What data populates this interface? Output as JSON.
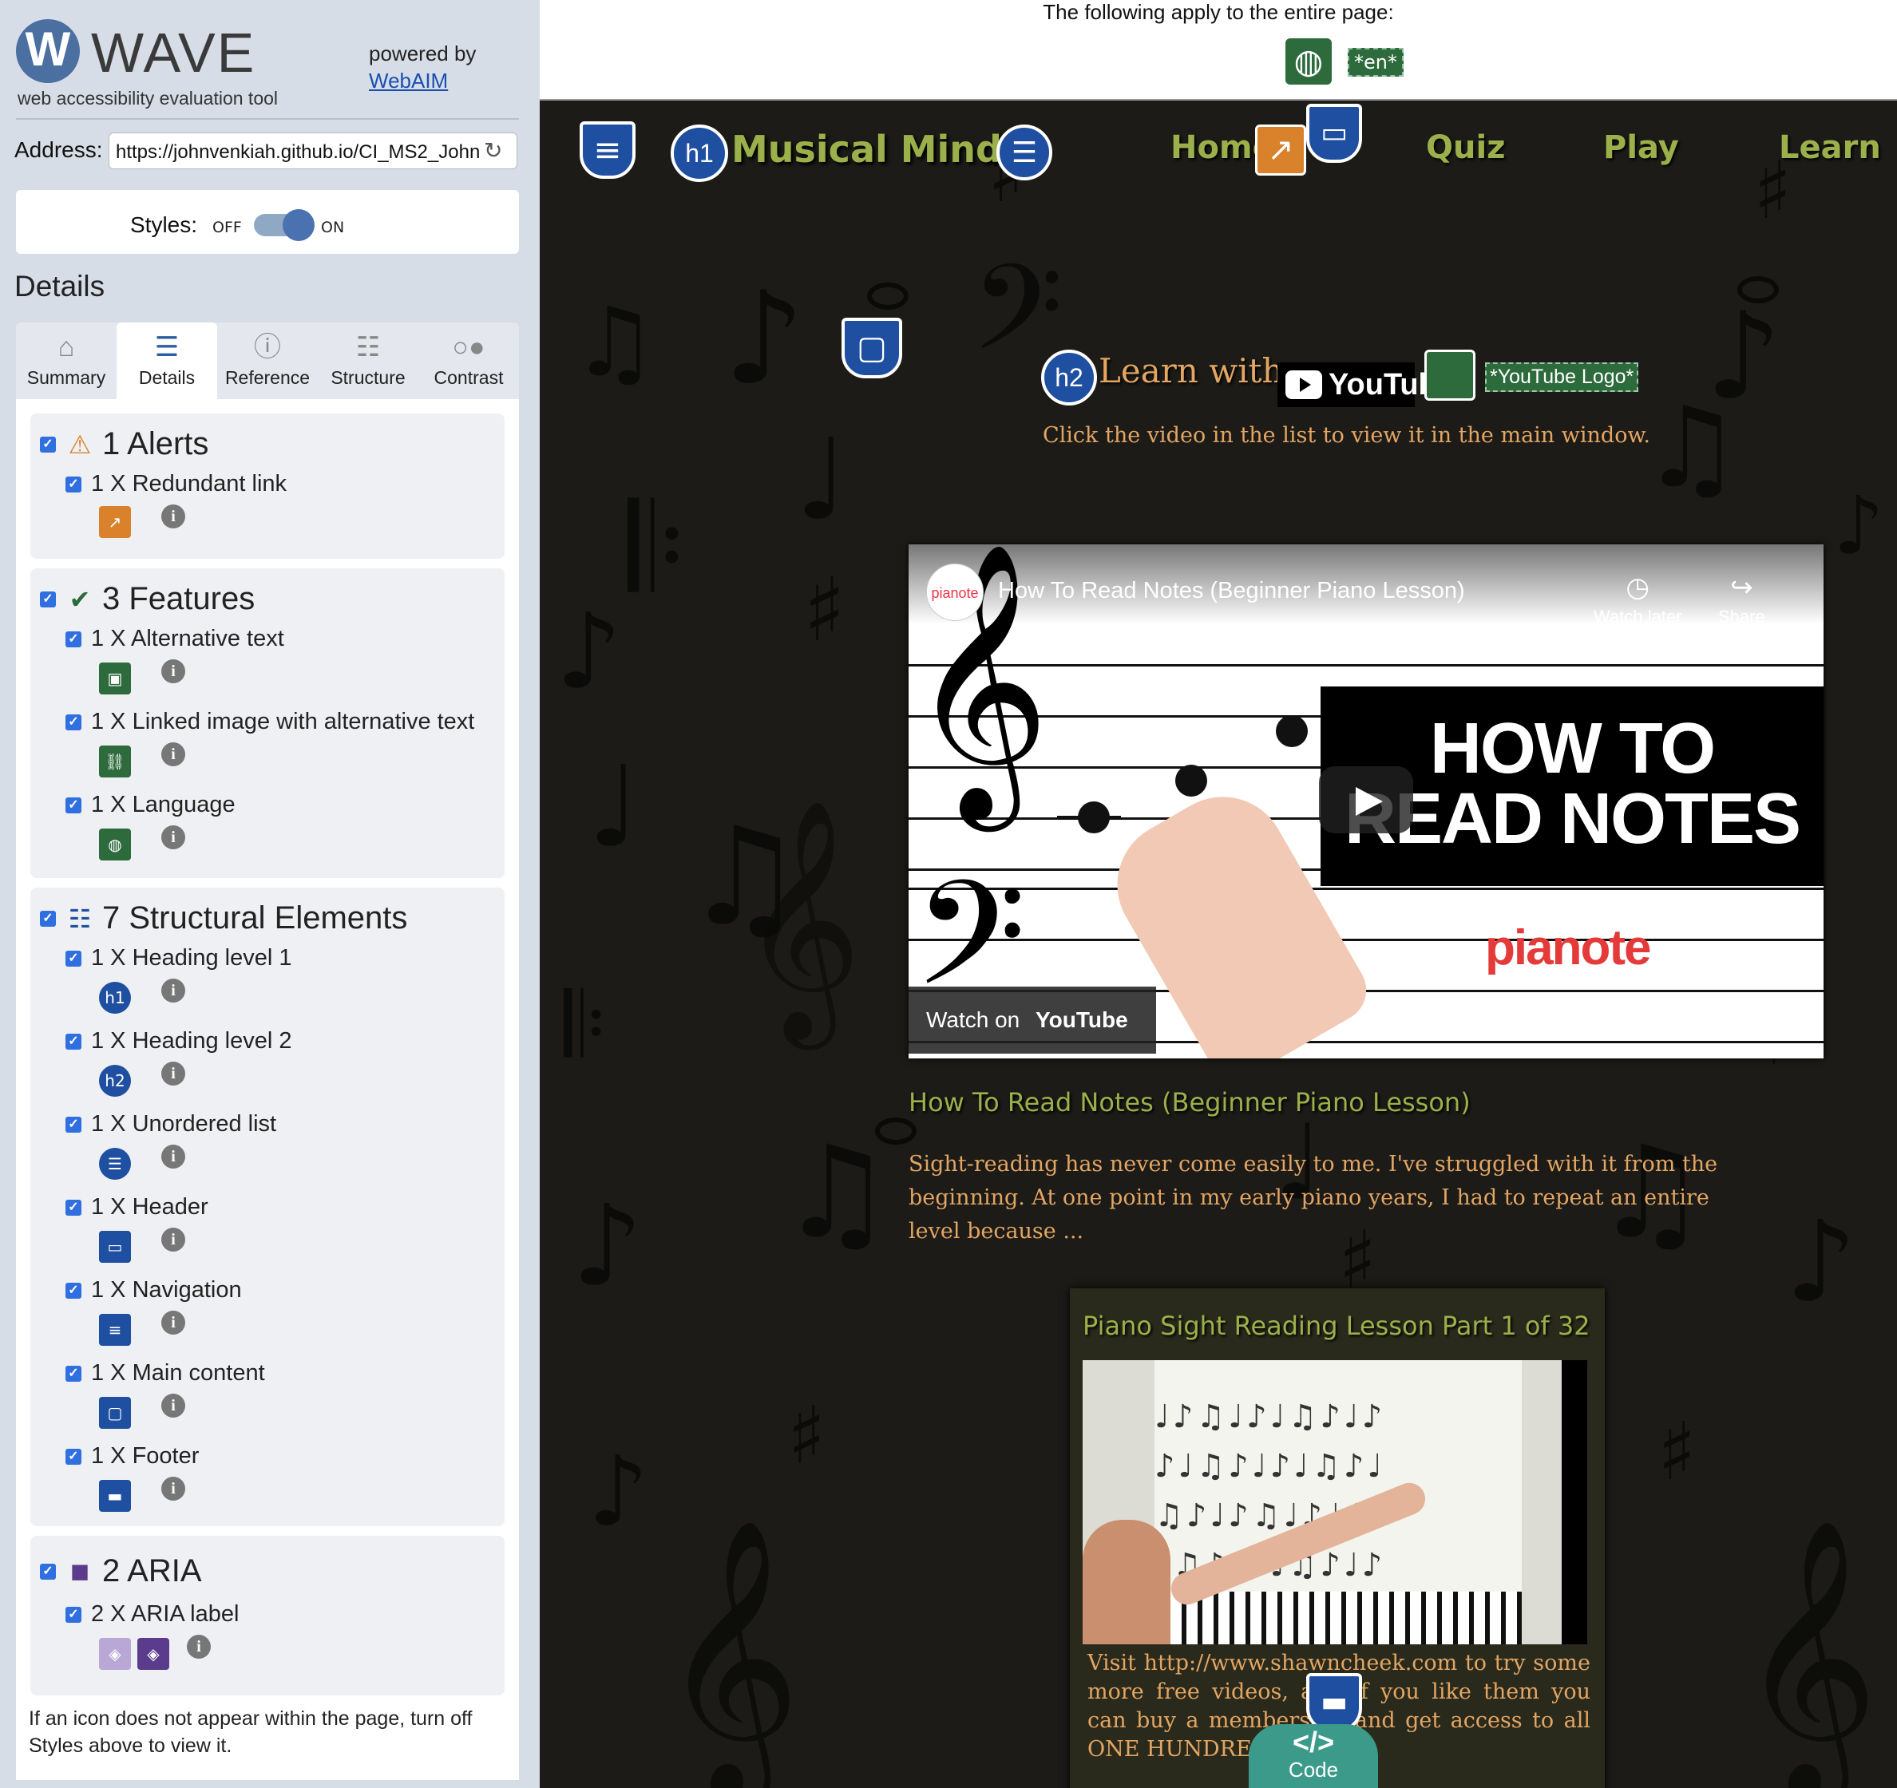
{
  "wave": {
    "logo_letter": "W",
    "title": "WAVE",
    "subtitle": "web accessibility evaluation tool",
    "powered_by": "powered by",
    "webaim": "WebAIM",
    "address_label": "Address:",
    "address_value": "https://johnvenkiah.github.io/CI_MS2_John",
    "styles_label": "Styles:",
    "styles_off": "OFF",
    "styles_on": "ON",
    "styles_state": "on",
    "details_heading": "Details",
    "tabs": [
      {
        "label": "Summary",
        "icon": "home-icon"
      },
      {
        "label": "Details",
        "icon": "list-icon"
      },
      {
        "label": "Reference",
        "icon": "info-icon"
      },
      {
        "label": "Structure",
        "icon": "hierarchy-icon"
      },
      {
        "label": "Contrast",
        "icon": "contrast-icon"
      }
    ],
    "active_tab": "Details",
    "groups": {
      "alerts": {
        "title": "1 Alerts",
        "items": [
          {
            "label": "1 X Redundant link"
          }
        ]
      },
      "features": {
        "title": "3 Features",
        "items": [
          {
            "label": "1 X Alternative text"
          },
          {
            "label": "1 X Linked image with alternative text"
          },
          {
            "label": "1 X Language"
          }
        ]
      },
      "structure": {
        "title": "7 Structural Elements",
        "items": [
          {
            "label": "1 X Heading level 1",
            "badge": "h1"
          },
          {
            "label": "1 X Heading level 2",
            "badge": "h2"
          },
          {
            "label": "1 X Unordered list"
          },
          {
            "label": "1 X Header"
          },
          {
            "label": "1 X Navigation"
          },
          {
            "label": "1 X Main content"
          },
          {
            "label": "1 X Footer"
          }
        ]
      },
      "aria": {
        "title": "2 ARIA",
        "items": [
          {
            "label": "2 X ARIA label"
          }
        ]
      }
    },
    "footnote": "If an icon does not appear within the page, turn off Styles above to view it.",
    "colors": {
      "sidebar_bg": "#d6dde7",
      "accent": "#1f4fa0",
      "feature_green": "#2d6a3c",
      "alert_orange": "#d9822b",
      "aria_purple": "#5b3c8c"
    }
  },
  "page": {
    "applies_text": "The following apply to the entire page:",
    "lang_tag": "*en*",
    "h1_badge": "h1",
    "h2_badge": "h2",
    "brand": "Musical Minds",
    "nav": [
      "Home",
      "Quiz",
      "Play",
      "Learn"
    ],
    "learn_heading": "Learn with",
    "youtube_badge": "YouTube",
    "alt_tag": "*YouTube Logo*",
    "instruction": "Click the video in the list to view it in the main window.",
    "video": {
      "channel": "pianote",
      "title": "How To Read Notes (Beginner Piano Lesson)",
      "watch_later": "Watch later",
      "share": "Share",
      "banner_line1": "HOW TO",
      "banner_line2": "READ NOTES",
      "brand_mark": "pianote",
      "watch_on": "Watch on",
      "youtube": "YouTube"
    },
    "video_caption": "How To Read Notes (Beginner Piano Lesson)",
    "video_description": "Sight-reading has never come easily to me. I've struggled with it from the beginning. At one point in my early piano years, I had to repeat an entire level because ...",
    "card": {
      "title": "Piano Sight Reading Lesson Part 1 of 32",
      "text": "Visit http://www.shawncheek.com to try some more free videos, and if you like them you can buy a membership and get access to all ONE HUNDRED AND ..."
    },
    "code_button": "Code",
    "code_symbol": "</>",
    "colors": {
      "background": "#1c1b17",
      "nav_green": "#9bb04a",
      "text_orange": "#e3a563"
    }
  }
}
